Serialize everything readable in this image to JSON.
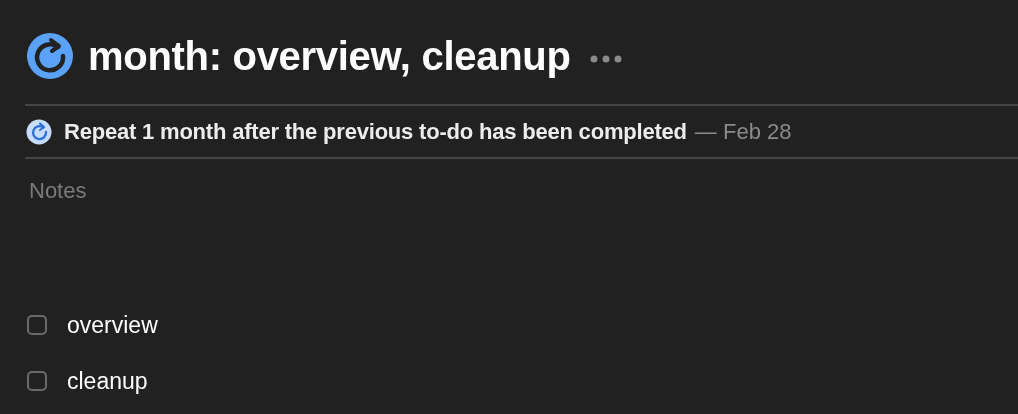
{
  "title": "month: overview, cleanup",
  "repeat": {
    "text": "Repeat 1 month after the previous to-do has been completed",
    "date": "— Feb 28"
  },
  "notes": {
    "placeholder": "Notes"
  },
  "checklist": [
    {
      "label": "overview",
      "checked": false
    },
    {
      "label": "cleanup",
      "checked": false
    }
  ]
}
